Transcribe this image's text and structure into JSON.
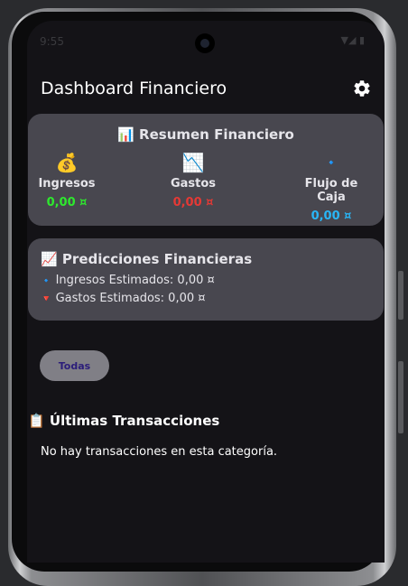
{
  "status_bar": {
    "time": "9:55",
    "icons": "▼◢ ▮"
  },
  "header": {
    "title": "Dashboard Financiero",
    "settings_icon": "gear-icon"
  },
  "summary": {
    "emoji": "📊",
    "title": "Resumen Financiero",
    "metrics": [
      {
        "emoji": "💰",
        "label": "Ingresos",
        "value": "0,00 ¤",
        "color": "#2ee82e"
      },
      {
        "emoji": "📉",
        "label": "Gastos",
        "value": "0,00 ¤",
        "color": "#e53935"
      },
      {
        "emoji": "🔹",
        "label": "Flujo de Caja",
        "value": "0,00 ¤",
        "color": "#29b6f6"
      }
    ]
  },
  "predictions": {
    "emoji": "📈",
    "title": "Predicciones Financieras",
    "items": [
      {
        "emoji": "🔹",
        "text": "Ingresos Estimados: 0,00 ¤"
      },
      {
        "emoji": "🔻",
        "text": "Gastos Estimados: 0,00 ¤"
      }
    ]
  },
  "filter": {
    "label": "Todas"
  },
  "transactions": {
    "emoji": "📋",
    "title": "Últimas Transacciones",
    "empty_text": "No hay transacciones en esta categoría."
  }
}
